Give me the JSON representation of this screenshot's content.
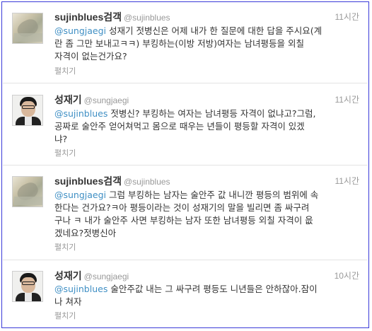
{
  "tweets": [
    {
      "name": "sujinblues검객",
      "handle": "@sujinblues",
      "time": "11시간",
      "mention": "@sungjaegi",
      "lines": [
        " 성재기 젓병신은 어제 내가 한 질문에 대한 답을 주시요(계",
        "란 좀 그만 보내고ㅋㅋ) 부킹하는(이방 저방)여자는 남녀평등을 외칠",
        "자격이 없는건가요?"
      ],
      "expand": "펼치기"
    },
    {
      "name": "성재기",
      "handle": "@sungjaegi",
      "time": "11시간",
      "mention": "@sujinblues",
      "lines": [
        " 젓병신? 부킹하는 여자는 남녀평등 자격이 없냐고?그럼,",
        "공짜로 술안주 얻어쳐먹고 몸으로 때우는 년들이 평등할 자격이 있겠",
        "냐?"
      ],
      "expand": "펼치기"
    },
    {
      "name": "sujinblues검객",
      "handle": "@sujinblues",
      "time": "11시간",
      "mention": "@sungjaegi",
      "lines": [
        " 그럼 부킹하는 남자는 술안주 값 내니깐 평등의 범위에 속",
        "한다는 건가요?ㅋ아 평등이라는 것이 성재기의 말을 빌리면 좀 싸구려",
        "구나 ㅋ 내가 술안주 사면 부킹하는 남자 또한 남녀평등 외칠 자격이 읎",
        "겠네요?젓병신아"
      ],
      "expand": "펼치기"
    },
    {
      "name": "성재기",
      "handle": "@sungjaegi",
      "time": "10시간",
      "mention": "@sujinblues",
      "lines": [
        " 술안주값 내는 그 싸구려 평등도 니년들은 안하잖아.잠이",
        "나 쳐자"
      ],
      "expand": "펼치기"
    }
  ]
}
